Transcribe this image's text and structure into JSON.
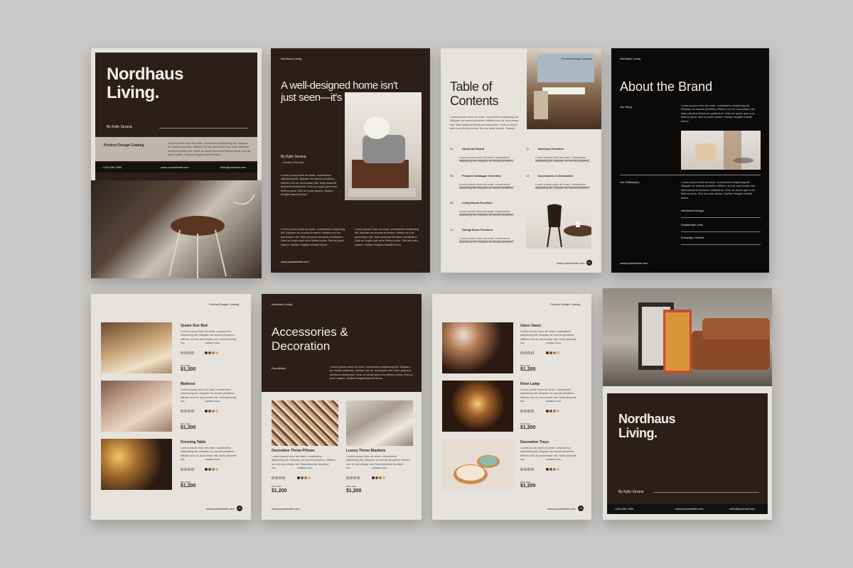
{
  "lorem": "Lorem ipsum dolor sit amet, consectetur adipiscing elit. Aliquam ac mauris pharetra, efficitur orci at, accumsan nisl. Nam placerat tincidunt vestibulum. Duis ac turpis quis eros finibus porta. Sed ac justo sapien. Nullam fringilla blandit lectus.",
  "cover": {
    "brand": "Nordhaus Living.",
    "author": "By Kylie Serana",
    "catalog": "Product Design Catalog",
    "phone": "+123-456-7890",
    "website": "www.yourwebsite.com",
    "email": "hello@yourmail.com"
  },
  "intro": {
    "header": "Nordhaus Living",
    "headline": "A well-designed home isn't just seen—it's felt",
    "author": "By Kylie Serana",
    "role": "- Creative Director",
    "website": "www.yourwebsite.com"
  },
  "toc": {
    "title": "Table of Contents",
    "header": "Product Design Catalog",
    "website": "www.yourwebsite.com",
    "page_badge": "01",
    "items": [
      {
        "num": "04",
        "label": "About the Brand"
      },
      {
        "num": "06",
        "label": "Product Catalogue Overview"
      },
      {
        "num": "08",
        "label": "Living Room Furniture"
      },
      {
        "num": "10",
        "label": "Dining Room Furniture"
      },
      {
        "num": "12",
        "label": "Bedroom Furniture"
      },
      {
        "num": "14",
        "label": "Accessories & Decoration"
      }
    ]
  },
  "about": {
    "header": "Nordhaus Living",
    "title": "About the Brand",
    "story": "Our Story",
    "philosophy": "Our Philosophy",
    "points": [
      "Intentional Design",
      "Sustainable Craft",
      "Everyday Comfort"
    ],
    "website": "www.yourwebsite.com"
  },
  "bedroom": {
    "header": "Product Design Catalog",
    "website": "www.yourwebsite.com",
    "page_badge": "02",
    "size_label": "Size",
    "colors_label": "Available Colors",
    "price_label": "Price Start",
    "products": [
      {
        "name": "Queen Size Bed",
        "price": "$1,200"
      },
      {
        "name": "Mattress",
        "price": "$1,200"
      },
      {
        "name": "Dressing Table",
        "price": "$1,200"
      }
    ]
  },
  "accessories": {
    "header": "Nordhaus Living",
    "title": "Accessories & Decoration",
    "description": "Description",
    "website": "www.yourwebsite.com",
    "size_label": "Size",
    "colors_label": "Available Colors",
    "price_label": "Price Start",
    "products": [
      {
        "name": "Decorative Throw Pillows",
        "price": "$1,200"
      },
      {
        "name": "Luxury Throw Blankets",
        "price": "$1,200"
      }
    ]
  },
  "decor": {
    "header": "Product Design Catalog",
    "website": "www.yourwebsite.com",
    "page_badge": "03",
    "size_label": "Size",
    "colors_label": "Available Colors",
    "price_label": "Price Start",
    "products": [
      {
        "name": "Glass Vases",
        "price": "$1,200"
      },
      {
        "name": "Floor Lamp",
        "price": "$1,200"
      },
      {
        "name": "Decorative Trays",
        "price": "$1,200"
      }
    ]
  },
  "back": {
    "brand": "Nordhaus Living.",
    "author": "By Kylie Serana",
    "phone": "+123-456-7890",
    "website": "www.yourwebsite.com",
    "email": "hello@yourmail.com"
  },
  "colors": {
    "dark_brown": "#2c1f1b",
    "paper": "#e6e3df",
    "black": "#0c0a09",
    "swatches": [
      "#3a2620",
      "#7a4b2e",
      "#b07a45",
      "#d9b27a"
    ]
  }
}
